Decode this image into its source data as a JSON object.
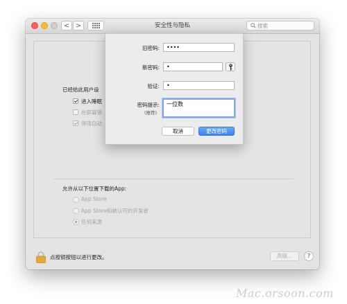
{
  "window": {
    "title": "安全性与隐私",
    "search_placeholder": "搜索",
    "back_glyph": "<",
    "forward_glyph": ">"
  },
  "main": {
    "section_title": "已经给此用户设",
    "checkboxes": [
      {
        "label": "进入睡眠",
        "checked": true,
        "enabled": true
      },
      {
        "label": "在屏幕锁",
        "checked": false,
        "enabled": false
      },
      {
        "label": "停用自动",
        "checked": true,
        "enabled": false
      }
    ],
    "downloads_title": "允许从以下位置下载的App:",
    "radios": [
      {
        "label": "App Store",
        "selected": false
      },
      {
        "label": "App Store和被认可的开发者",
        "selected": false
      },
      {
        "label": "任何来源",
        "selected": true
      }
    ]
  },
  "footer": {
    "lock_text": "点按锁按钮以进行更改。",
    "advanced_label": "高级...",
    "help_label": "?"
  },
  "sheet": {
    "old_password_label": "旧密码:",
    "old_password_value": "••••",
    "new_password_label": "新密码:",
    "new_password_value": "•",
    "verify_label": "验证:",
    "verify_value": "•",
    "hint_label": "密码提示:",
    "hint_sublabel": "(推荐)",
    "hint_value": "一位数",
    "cancel_label": "取消",
    "change_label": "更改密码"
  },
  "watermark": "Mac.orsoon.com",
  "colors": {
    "accent": "#3b83f2",
    "focus_ring": "#7fa6e8",
    "close": "#fc5f57",
    "minimize": "#fdbc2e"
  }
}
